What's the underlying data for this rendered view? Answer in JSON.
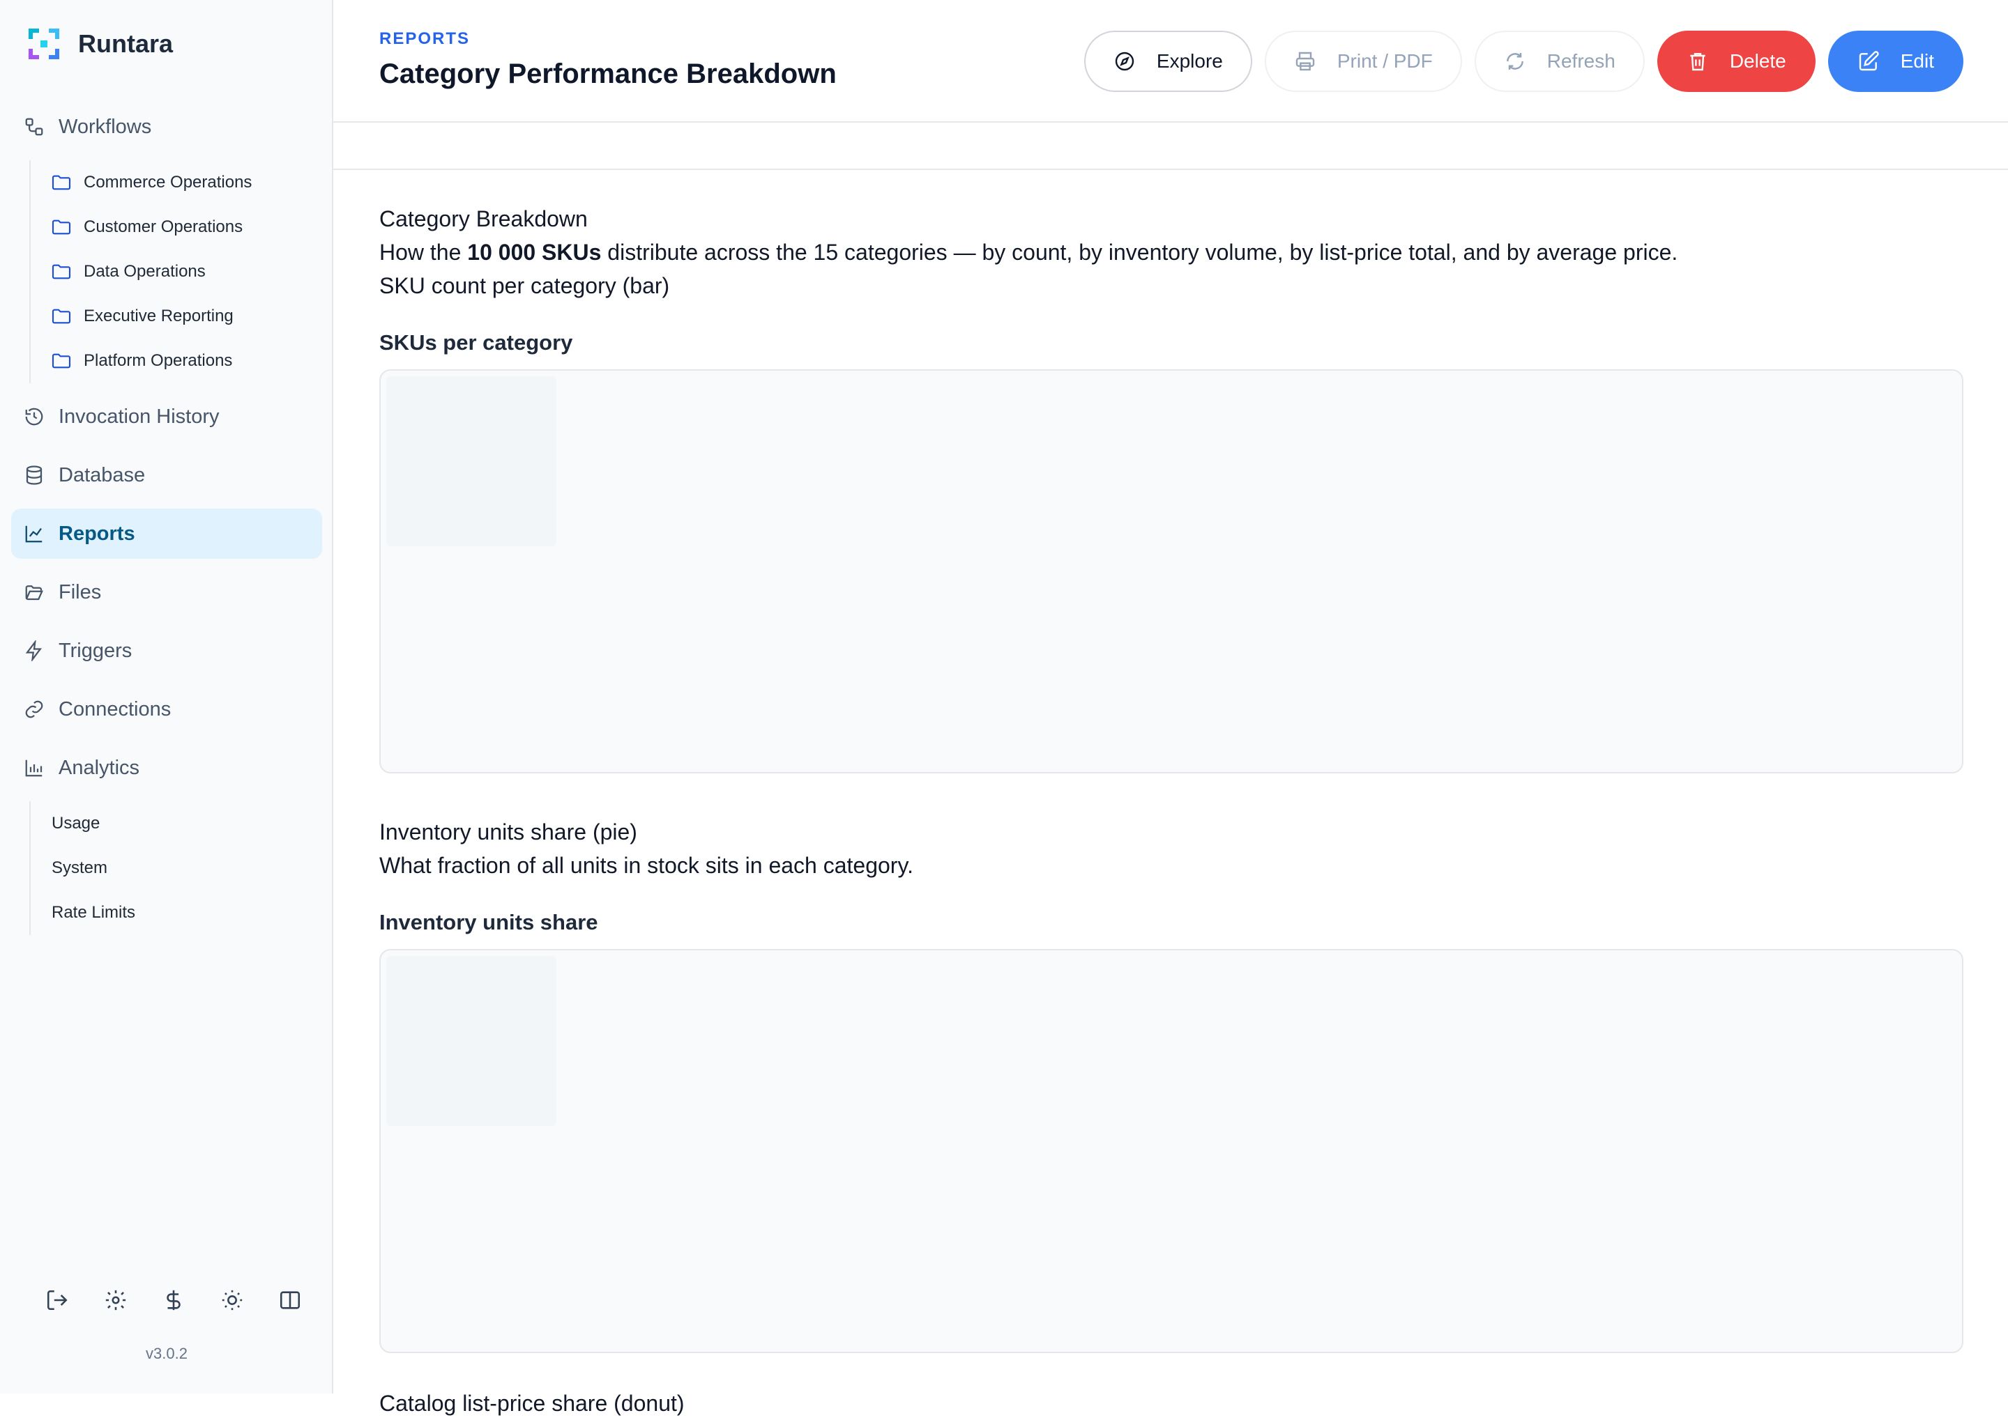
{
  "brand": {
    "name": "Runtara"
  },
  "sidebar": {
    "items": [
      {
        "label": "Workflows",
        "icon": "workflow-icon"
      },
      {
        "label": "Invocation History",
        "icon": "history-icon"
      },
      {
        "label": "Database",
        "icon": "database-icon"
      },
      {
        "label": "Reports",
        "icon": "chart-line-icon",
        "active": true
      },
      {
        "label": "Files",
        "icon": "folder-open-icon"
      },
      {
        "label": "Triggers",
        "icon": "lightning-icon"
      },
      {
        "label": "Connections",
        "icon": "link-icon"
      },
      {
        "label": "Analytics",
        "icon": "bar-chart-icon"
      }
    ],
    "workflow_folders": [
      "Commerce Operations",
      "Customer Operations",
      "Data Operations",
      "Executive Reporting",
      "Platform Operations"
    ],
    "analytics_items": [
      "Usage",
      "System",
      "Rate Limits"
    ],
    "version": "v3.0.2"
  },
  "header": {
    "breadcrumb": "REPORTS",
    "title": "Category Performance Breakdown",
    "buttons": {
      "explore": "Explore",
      "print": "Print / PDF",
      "refresh": "Refresh",
      "delete": "Delete",
      "edit": "Edit"
    }
  },
  "content": {
    "section_title": "Category Breakdown",
    "desc_prefix": "How the ",
    "desc_bold": "10 000 SKUs",
    "desc_suffix": " distribute across the 15 categories — by count, by inventory volume, by list-price total, and by average price.",
    "bar_caption": "SKU count per category (bar)",
    "bar_title": "SKUs per category",
    "pie_caption": "Inventory units share (pie)",
    "pie_desc": "What fraction of all units in stock sits in each category.",
    "pie_title": "Inventory units share",
    "donut_caption": "Catalog list-price share (donut)"
  },
  "colors": {
    "accent": "#2563eb",
    "danger": "#ef4444",
    "primary": "#3b82f6",
    "active_bg": "#e0f2fe"
  }
}
